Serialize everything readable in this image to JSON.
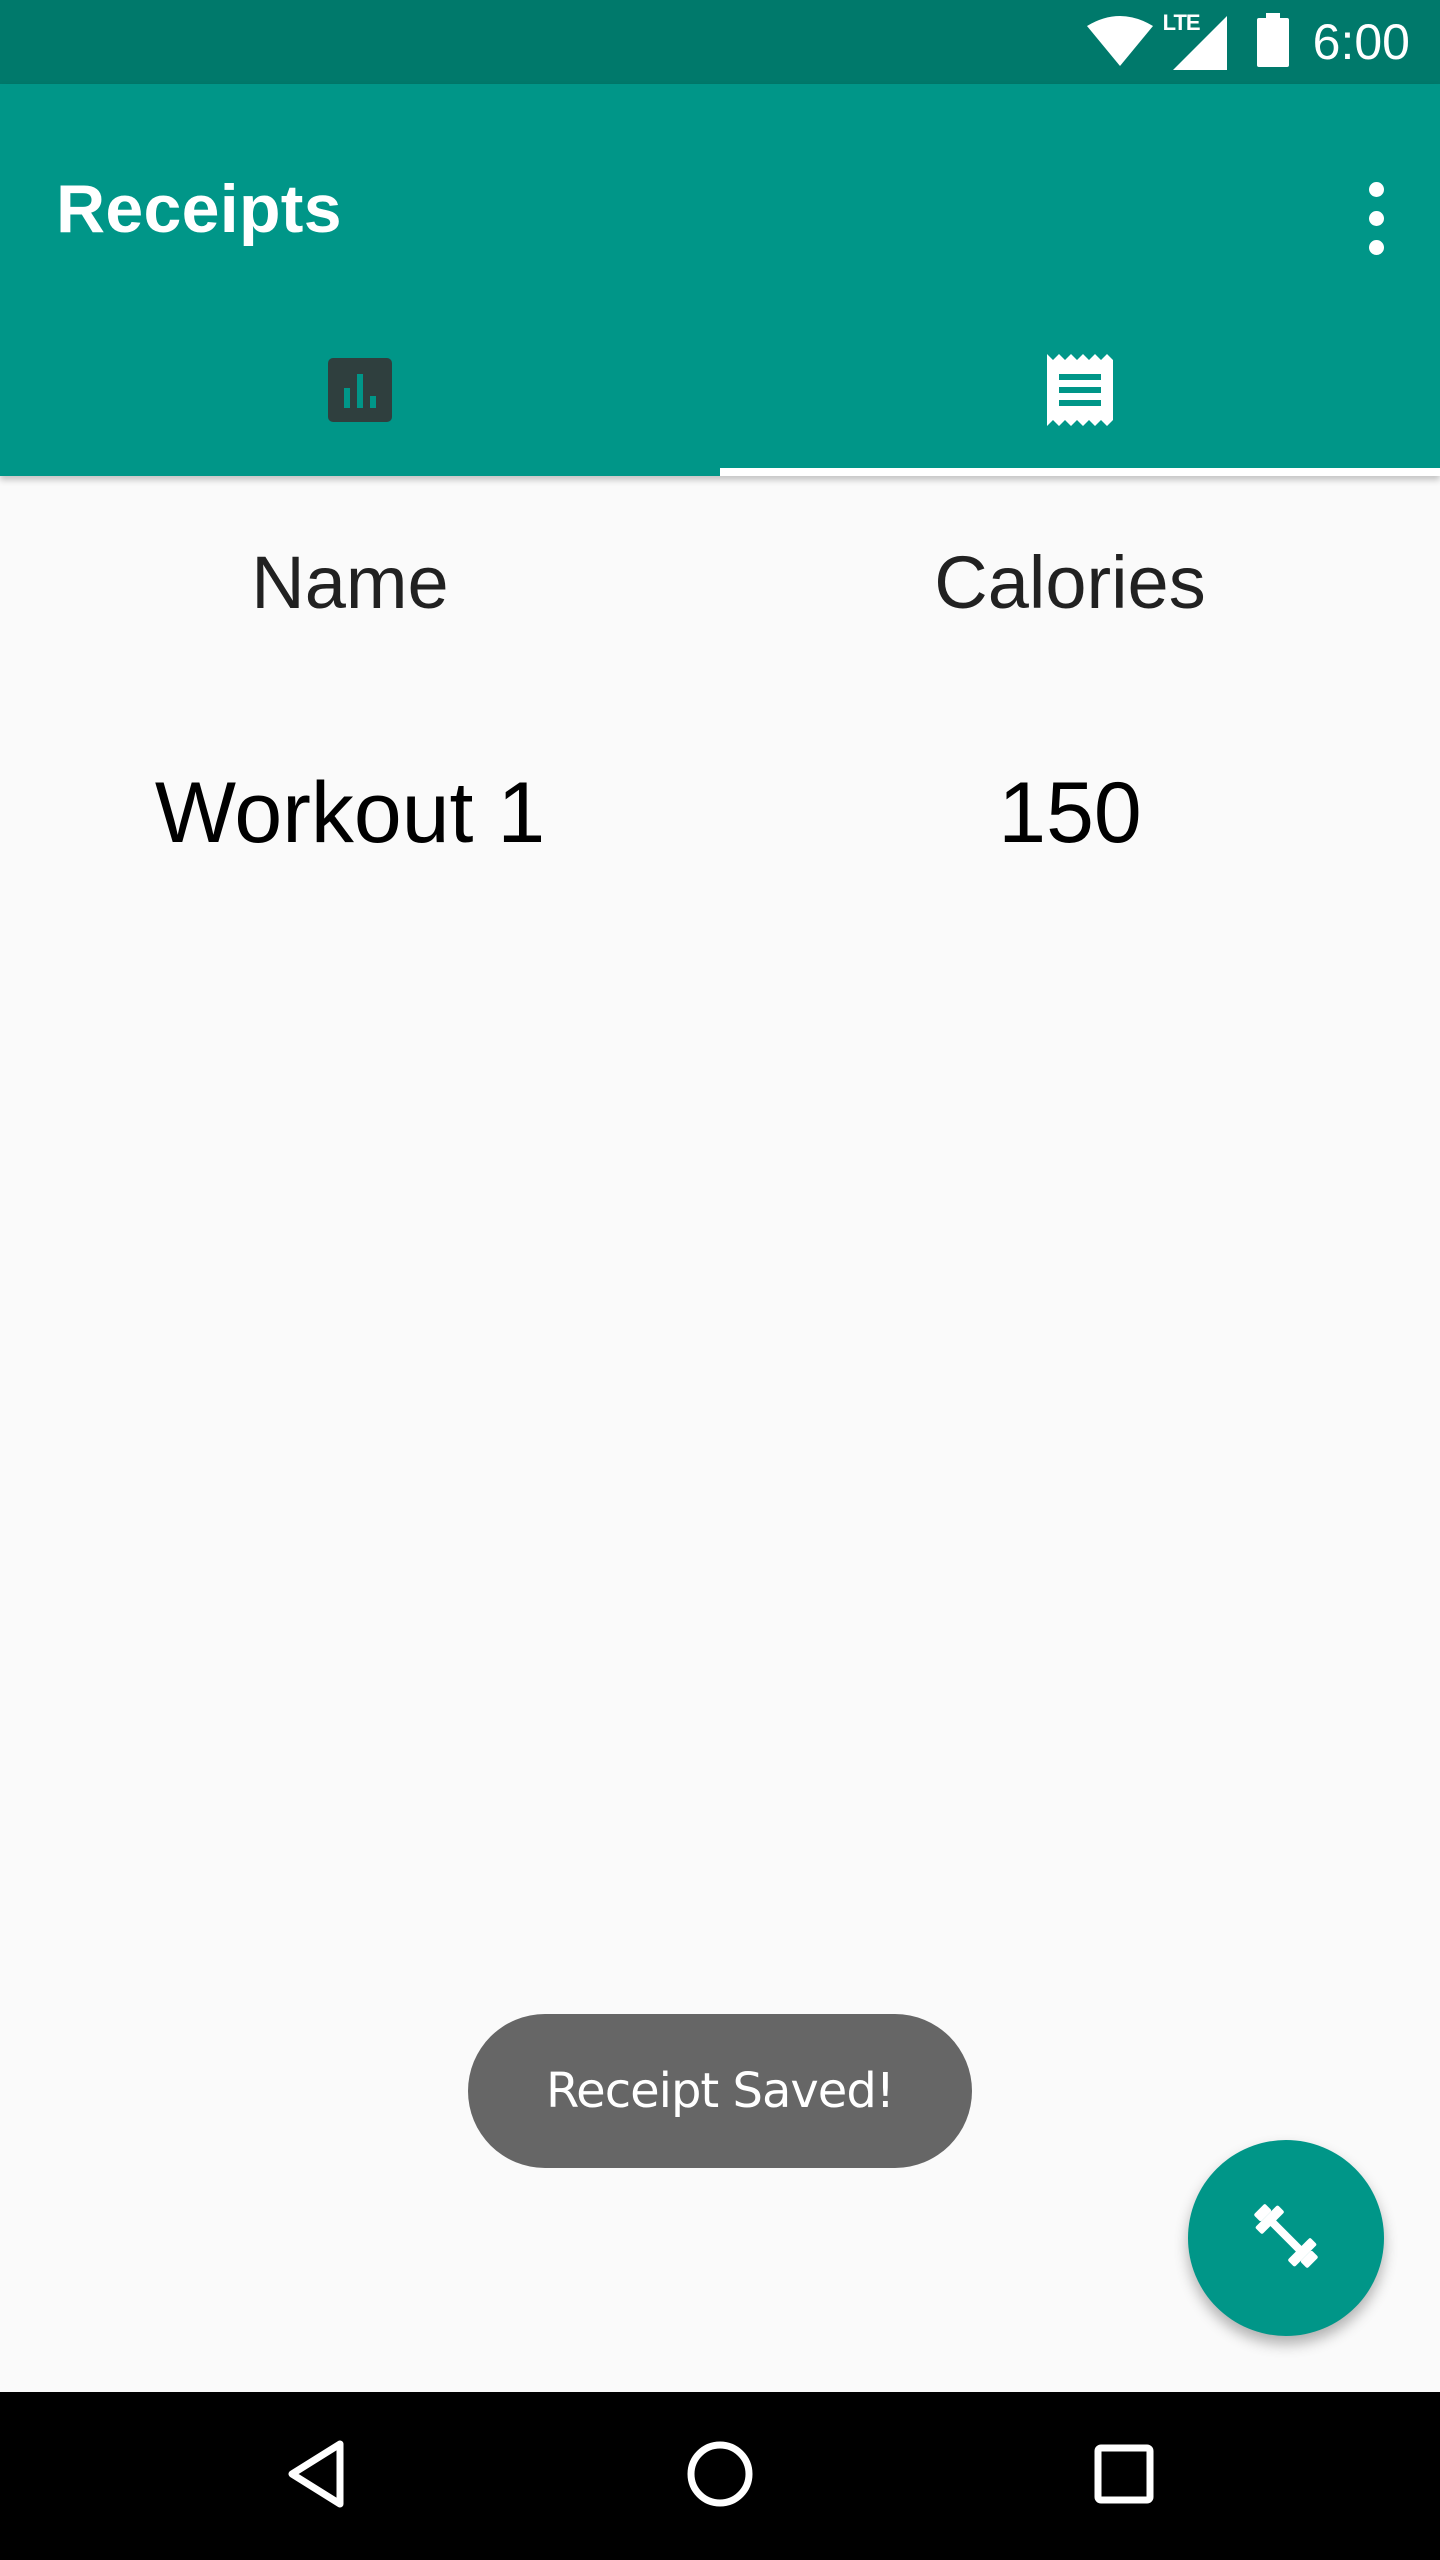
{
  "status_bar": {
    "time": "6:00",
    "network": "LTE",
    "icons": [
      "wifi-icon",
      "cell-signal-icon",
      "battery-icon"
    ]
  },
  "app_bar": {
    "title": "Receipts",
    "menu_icon": "more-vert-icon",
    "tabs": [
      {
        "icon": "bar-chart-icon",
        "selected": false
      },
      {
        "icon": "receipt-icon",
        "selected": true
      }
    ]
  },
  "table": {
    "headers": [
      "Name",
      "Calories"
    ],
    "rows": [
      {
        "name": "Workout 1",
        "calories": "150"
      }
    ]
  },
  "toast": {
    "message": "Receipt Saved!"
  },
  "fab": {
    "icon": "fitness-center-icon"
  },
  "nav_bar": {
    "buttons": [
      "back-icon",
      "home-icon",
      "recents-icon"
    ]
  },
  "colors": {
    "primary": "#009688",
    "primary_dark": "#00796b",
    "background": "#fafafa",
    "toast": "#666666"
  }
}
